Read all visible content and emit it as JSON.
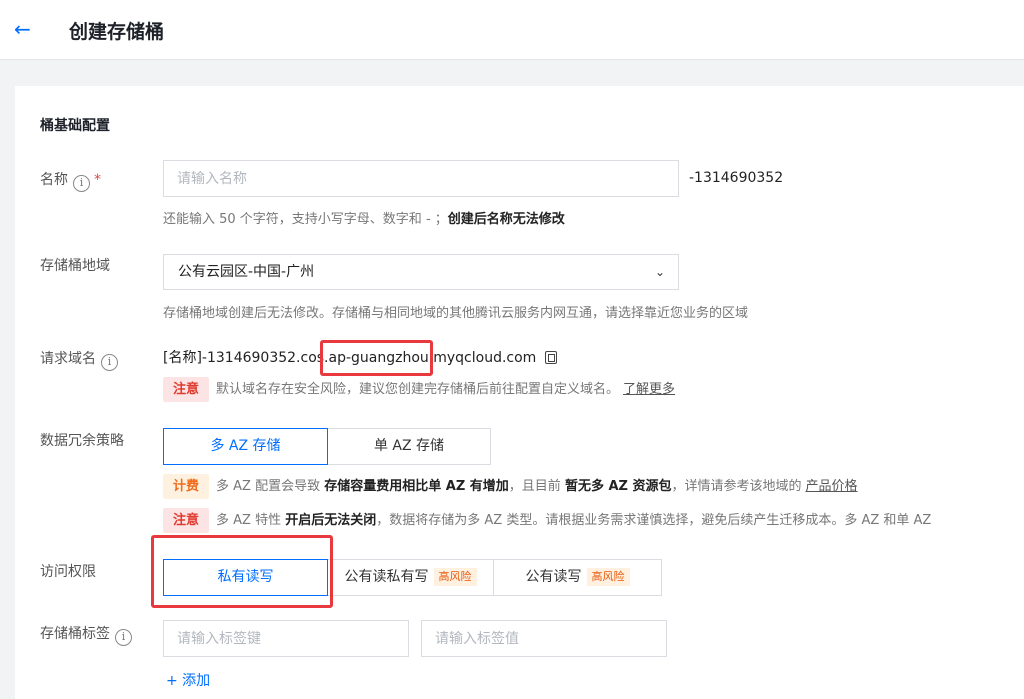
{
  "header": {
    "back_icon": "←",
    "title": "创建存储桶"
  },
  "section": {
    "title": "桶基础配置"
  },
  "name_field": {
    "label": "名称",
    "required_mark": "*",
    "placeholder": "请输入名称",
    "suffix": "-1314690352",
    "hint": "还能输入 50 个字符，支持小写字母、数字和 - ；",
    "hint_bold": "创建后名称无法修改"
  },
  "region_field": {
    "label": "存储桶地域",
    "value": "公有云园区-中国-广州",
    "hint": "存储桶地域创建后无法修改。存储桶与相同地域的其他腾讯云服务内网互通，请选择靠近您业务的区域"
  },
  "domain_field": {
    "label": "请求域名",
    "prefix": "[名称]-1314690352.cos.",
    "region_part": "ap-guangzhou.",
    "suffix": "myqcloud.com",
    "warn_tag": "注意",
    "warn_text": "默认域名存在安全风险，建议您创建完存储桶后前往配置自定义域名。",
    "link": "了解更多"
  },
  "redundancy_field": {
    "label": "数据冗余策略",
    "options": [
      "多 AZ 存储",
      "单 AZ 存储"
    ],
    "selected": "多 AZ 存储",
    "fee_tag": "计费",
    "fee_text_1": "多 AZ 配置会导致",
    "fee_bold_1": "存储容量费用相比单 AZ 有增加",
    "fee_text_2": "，且目前",
    "fee_bold_2": "暂无多 AZ 资源包",
    "fee_text_3": "，详情请参考该地域的",
    "fee_link": "产品价格",
    "note_tag": "注意",
    "note_text_1": "多 AZ 特性",
    "note_bold": "开启后无法关闭",
    "note_text_2": "，数据将存储为多 AZ 类型。请根据业务需求谨慎选择，避免后续产生迁移成本。多 AZ 和单 AZ"
  },
  "access_field": {
    "label": "访问权限",
    "options": [
      {
        "label": "私有读写",
        "risk": ""
      },
      {
        "label": "公有读私有写",
        "risk": "高风险"
      },
      {
        "label": "公有读写",
        "risk": "高风险"
      }
    ],
    "selected": "私有读写"
  },
  "tag_field": {
    "label": "存储桶标签",
    "key_placeholder": "请输入标签键",
    "value_placeholder": "请输入标签值",
    "add_label": "+ 添加"
  },
  "colors": {
    "accent": "#006eff",
    "highlight_box": "#e8393f",
    "warn": "#e0392d",
    "fee": "#f06b1a"
  }
}
